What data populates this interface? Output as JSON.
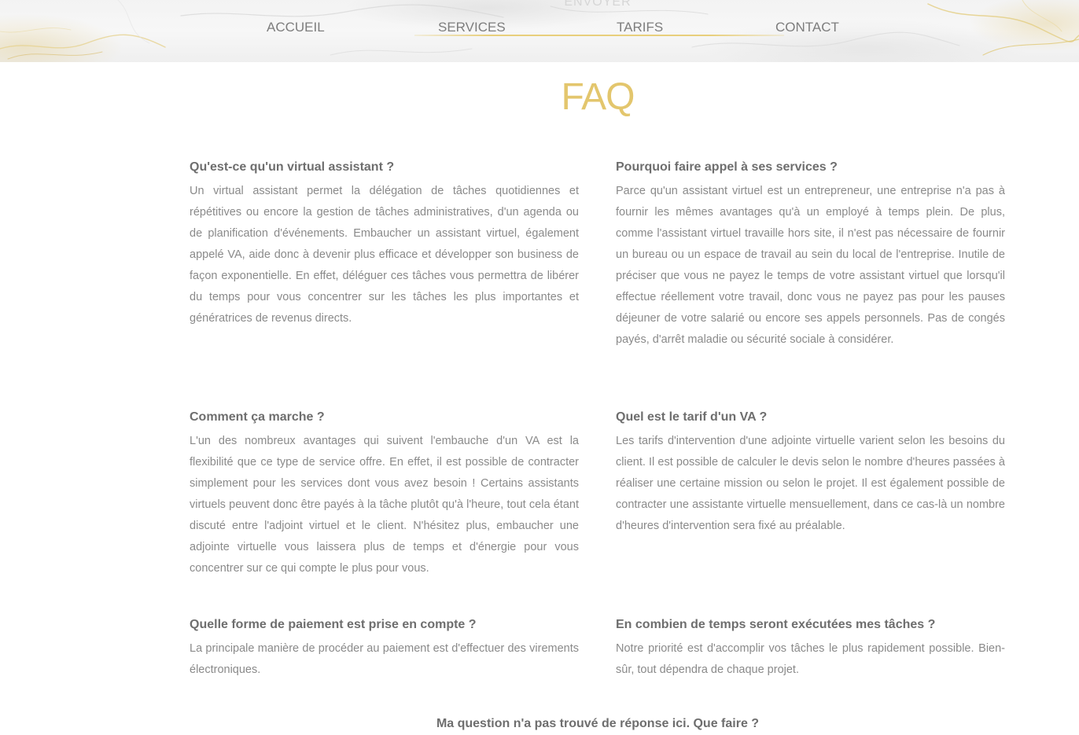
{
  "header": {
    "faded_label": "ENVOYER",
    "nav": [
      {
        "label": "ACCUEIL"
      },
      {
        "label": "SERVICES"
      },
      {
        "label": "TARIFS"
      },
      {
        "label": "CONTACT"
      }
    ]
  },
  "colors": {
    "accent_gold": "#e3c66d",
    "heading_gray": "#6e6e6e",
    "text_gray": "#8a8a8a",
    "nav_gray": "#7d7d7d"
  },
  "faq": {
    "title": "FAQ",
    "items": [
      {
        "question": "Qu'est-ce qu'un virtual assistant ?",
        "answer": "Un virtual assistant permet la délégation de tâches quotidiennes et répétitives ou encore la gestion de tâches administratives, d'un agenda ou de planification d'événements. Embaucher un assistant virtuel, également appelé VA, aide donc à devenir plus efficace et développer son business de façon exponentielle. En effet, déléguer ces tâches vous permettra de libérer du temps pour vous concentrer sur les tâches les plus importantes et génératrices de revenus directs."
      },
      {
        "question": "Pourquoi faire appel à ses services ?",
        "answer": "Parce qu'un assistant virtuel est un entrepreneur, une entreprise n'a pas à fournir les mêmes avantages qu'à un employé à temps plein. De plus, comme l'assistant virtuel travaille hors site, il n'est pas nécessaire de fournir un bureau ou un espace de travail au sein du local de l'entreprise. Inutile de préciser que vous ne payez le temps de votre assistant virtuel que lorsqu'il effectue réellement votre travail, donc vous ne payez pas pour les pauses déjeuner de votre salarié ou encore ses appels personnels. Pas de congés payés, d'arrêt maladie ou sécurité sociale à considérer."
      },
      {
        "question": "Comment ça marche ?",
        "answer": "L'un des nombreux avantages qui suivent l'embauche d'un VA est la flexibilité que ce type de service offre. En effet, il est possible de contracter simplement pour les services dont vous avez besoin ! Certains assistants virtuels peuvent donc être payés à la tâche plutôt qu'à l'heure, tout cela étant discuté entre l'adjoint virtuel et le client. N'hésitez plus, embaucher une adjointe virtuelle vous laissera plus de temps et d'énergie pour vous concentrer sur ce qui compte le plus pour vous."
      },
      {
        "question": "Quel est le tarif d'un VA ?",
        "answer": "Les tarifs d'intervention d'une adjointe virtuelle varient selon les besoins du client. Il est possible de calculer le devis selon le nombre d'heures passées à réaliser une certaine mission ou selon le projet. Il est également possible de contracter une assistante virtuelle mensuellement, dans ce cas-là un nombre d'heures d'intervention sera fixé au préalable."
      },
      {
        "question": "Quelle forme de paiement est prise en compte ?",
        "answer": "La principale manière de procéder au paiement est d'effectuer des virements électroniques."
      },
      {
        "question": "En combien de temps seront exécutées mes tâches ?",
        "answer": "Notre priorité est d'accomplir vos tâches le plus rapidement possible. Bien-sûr, tout dépendra de chaque projet."
      }
    ],
    "bottom_question": "Ma question n'a pas trouvé de réponse ici. Que faire ?"
  }
}
